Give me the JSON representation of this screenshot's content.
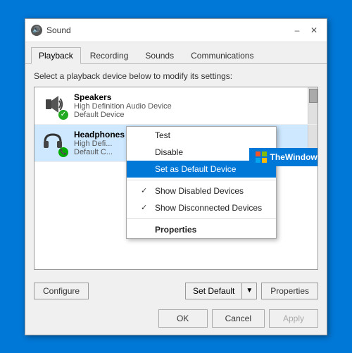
{
  "window": {
    "title": "Sound",
    "title_icon": "🔊"
  },
  "tabs": [
    {
      "label": "Playback",
      "active": true
    },
    {
      "label": "Recording",
      "active": false
    },
    {
      "label": "Sounds",
      "active": false
    },
    {
      "label": "Communications",
      "active": false
    }
  ],
  "instruction": "Select a playback device below to modify its settings:",
  "devices": [
    {
      "name": "Speakers",
      "sub1": "High Definition Audio Device",
      "sub2": "Default Device",
      "badge": "check",
      "selected": false
    },
    {
      "name": "Headphones",
      "sub1": "High Defi...",
      "sub2": "Default C...",
      "badge": "phone",
      "selected": true
    }
  ],
  "context_menu": {
    "items": [
      {
        "label": "Test",
        "check": "",
        "highlighted": false,
        "bold": false
      },
      {
        "label": "Disable",
        "check": "",
        "highlighted": false,
        "bold": false
      },
      {
        "label": "Set as Default Device",
        "check": "",
        "highlighted": true,
        "bold": false
      },
      {
        "separator": true
      },
      {
        "label": "Show Disabled Devices",
        "check": "✓",
        "highlighted": false,
        "bold": false
      },
      {
        "label": "Show Disconnected Devices",
        "check": "✓",
        "highlighted": false,
        "bold": false
      },
      {
        "separator": true
      },
      {
        "label": "Properties",
        "check": "",
        "highlighted": false,
        "bold": true
      }
    ]
  },
  "bottom": {
    "configure_label": "Configure",
    "set_default_label": "Set Default",
    "properties_label": "Properties"
  },
  "dialog_buttons": {
    "ok": "OK",
    "cancel": "Cancel",
    "apply": "Apply"
  },
  "watermark": "TheWindowsClub"
}
